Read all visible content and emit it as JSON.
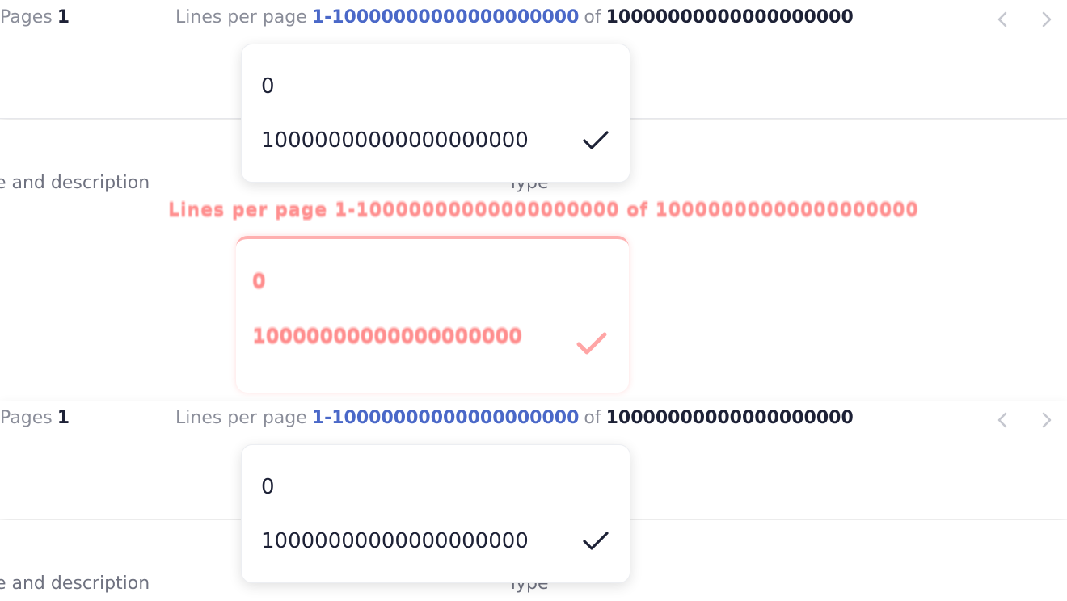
{
  "pagination": {
    "pages_label": "Pages",
    "pages_value": "1",
    "lines_per_page_label": "Lines per page",
    "range": "1-10000000000000000000",
    "of_label": "of",
    "total": "10000000000000000000",
    "prev_icon": "chevron-left-icon",
    "next_icon": "chevron-right-icon"
  },
  "dropdown": {
    "options": [
      {
        "label": "0",
        "selected": false
      },
      {
        "label": "10000000000000000000",
        "selected": true
      }
    ],
    "check_icon": "check-icon"
  },
  "table_header": {
    "name_col": "ne and description",
    "type_col": "Type"
  },
  "ghost": {
    "text": "Lines per page 1-10000000000000000000 of 10000000000000000000",
    "options": [
      "0",
      "10000000000000000000"
    ]
  },
  "colors": {
    "accent": "#4a68c8",
    "muted": "#8a8d99",
    "ink": "#1d2136",
    "ghost": "#ff6b6b"
  }
}
